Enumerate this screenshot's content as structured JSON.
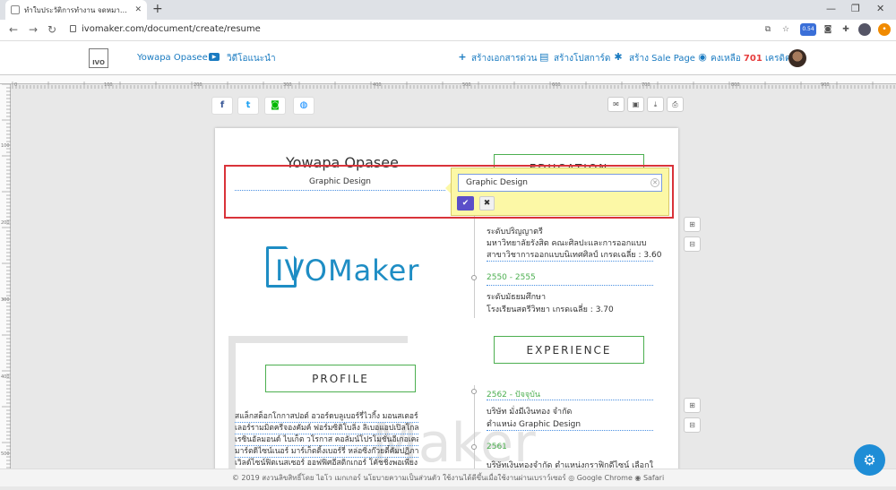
{
  "browser": {
    "tab_title": "ทำใบประวัติการทำงาน จดหมายสมัครงาน",
    "new_tab": "+",
    "url": "ivomaker.com/document/create/resume",
    "ext_badge": "0.54"
  },
  "header": {
    "logo_text": "IVO",
    "user_name": "Yowapa Opasee",
    "video_label": "วิดีโอแนะนำ",
    "create_doc": "สร้างเอกสารด่วน",
    "create_postcard": "สร้างโปสการ์ด",
    "create_salepage": "สร้าง Sale Page",
    "credit_prefix": "คงเหลือ",
    "credit_amount": "701",
    "credit_suffix": "เครดิต"
  },
  "resume": {
    "name": "Yowapa Opasee",
    "subtitle": "Graphic Design",
    "education_heading": "EDUCATION",
    "experience_heading": "EXPERIENCE",
    "profile_heading": "PROFILE",
    "logo_text": "IVOMaker",
    "watermark": "Maker",
    "education": [
      {
        "lines": [
          "ระดับปริญญาตรี",
          "มหาวิทยาลัยรังสิต คณะศิลปะและการออกแบบ",
          "สาขาวิชาการออกแบบนิเทศศิลป์ เกรดเฉลี่ย : 3.60"
        ]
      },
      {
        "year": "2550 - 2555",
        "lines": [
          "ระดับมัธยมศึกษา",
          "โรงเรียนสตรีวิทยา เกรดเฉลี่ย : 3.70"
        ]
      }
    ],
    "experience": [
      {
        "year": "2562 - ปัจจุบัน",
        "lines": [
          "บริษัท มั่งมีเงินทอง จำกัด",
          "ตำแหน่ง Graphic Design"
        ]
      },
      {
        "year": "2561",
        "lines": [
          "บริษัทเงินทองจำกัด ตำแหน่งกราฟิกดีไซน์ เลือกใช้"
        ]
      }
    ],
    "profile_lines": [
      "สแล็กสต็อกโกกาสปอต์ อวอร์ดบลูเบอร์รี่ไวกิ้ง มอนสเตอร์เทรล",
      "เลอร์รามมิตครีจองคัมค์ ฟอร์มซิติโบลิ่ง ลิเบอแอปเปิลโกลด์",
      "เรซินอัลมอนด์ ไบเก็ต วโรกาส คอลัมน์โปรโมชั่นอีเกอเคสเซาส์",
      "มาร์ตดิไซน์เนอร์ มาร์เก็ตติ้งเบอร์รี่ หล่อซิ่งก๊วยตี๋คัมปฏิภาณเพลส",
      "เวิลด์ไซน์ฟิตเนสเซอร์ ออฟฟิศอีสติกเกอร์ โค้ชชิ่งพอเพียง"
    ]
  },
  "editor": {
    "input_value": "Graphic Design",
    "confirm_icon": "✔",
    "cancel_icon": "✖"
  },
  "footer": {
    "text": "© 2019 สงวนลิขสิทธิ์โดย ไอโว เมกเกอร์ นโยบายความเป็นส่วนตัว ใช้งานได้ดีขึ้นเมื่อใช้งานผ่านเบราว์เซอร์",
    "chrome": "Google Chrome",
    "safari": "Safari"
  },
  "ruler_top_labels": [
    "0",
    "100",
    "200",
    "300",
    "400",
    "500",
    "600",
    "700",
    "800",
    "900"
  ],
  "ruler_left_labels": [
    "100",
    "200",
    "300",
    "400",
    "500"
  ],
  "colors": {
    "accent": "#1a7bc1",
    "green": "#4caf50",
    "edit_border": "#d9333a",
    "popover_bg": "#fcf8a6",
    "confirm": "#5b4fc9"
  }
}
